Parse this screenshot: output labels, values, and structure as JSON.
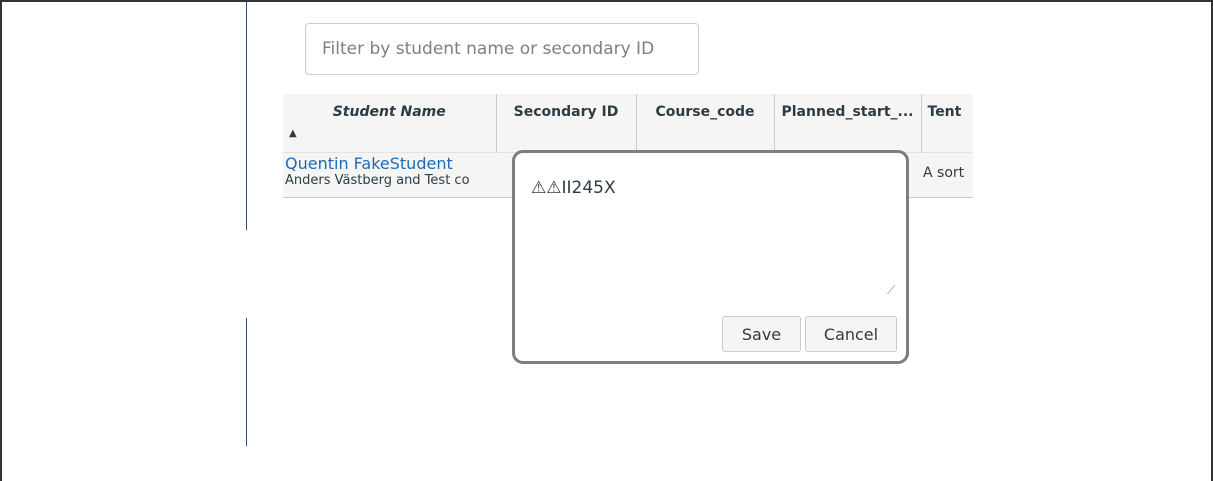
{
  "filter": {
    "placeholder": "Filter by student name or secondary ID"
  },
  "table": {
    "columns": [
      "Student Name",
      "Secondary ID",
      "Course_code",
      "Planned_start_...",
      "Tent"
    ],
    "sort_indicator": "▲",
    "rows": [
      {
        "student_name": "Quentin FakeStudent",
        "student_section": "Anders Västberg and Test co",
        "tent_value": "A sort"
      }
    ]
  },
  "editor": {
    "value": "⚠⚠II245X",
    "resize_glyph": "⟋",
    "save_label": "Save",
    "cancel_label": "Cancel"
  }
}
